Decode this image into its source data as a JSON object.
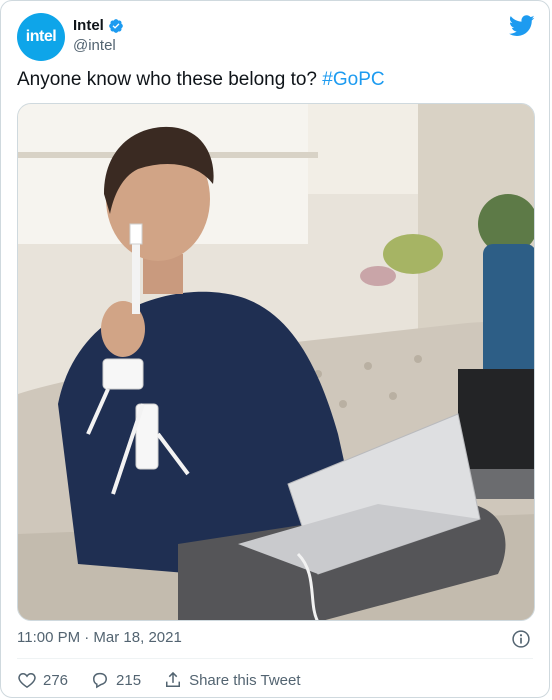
{
  "author": {
    "name": "Intel",
    "handle": "@intel",
    "avatar_text": "intel",
    "brand_color": "#0ea5e9",
    "verified_color": "#1d9bf0"
  },
  "tweet": {
    "text": "Anyone know who these belong to? ",
    "hashtag": "#GoPC",
    "timestamp": "11:00 PM · Mar 18, 2021"
  },
  "media": {
    "type": "photo"
  },
  "actions": {
    "like_count": "276",
    "reply_count": "215",
    "share_label": "Share this Tweet"
  },
  "icons": {
    "bird": "twitter-bird-icon",
    "info": "info-icon",
    "like": "heart-icon",
    "reply": "reply-bubble-icon",
    "share": "share-icon"
  }
}
